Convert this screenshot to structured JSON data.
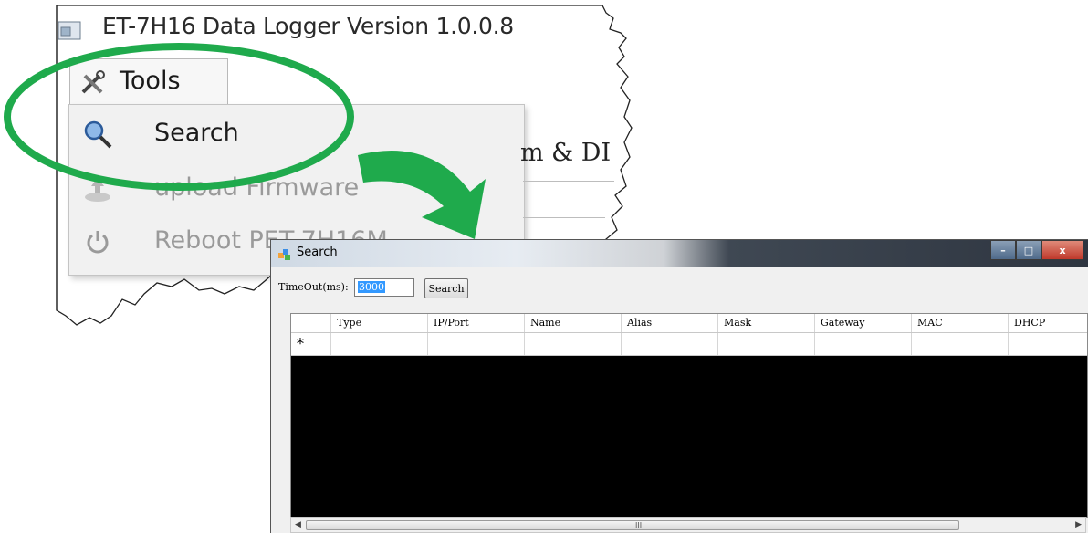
{
  "background_window": {
    "title": "ET-7H16 Data Logger Version 1.0.0.8",
    "tools_tab_label": "Tools",
    "menu_items": [
      {
        "label": "Search",
        "icon": "search-icon",
        "enabled": true
      },
      {
        "label": "upload Firmware",
        "icon": "upload-icon",
        "enabled": false
      },
      {
        "label": "Reboot PET-7H16M",
        "icon": "power-icon",
        "enabled": false
      }
    ],
    "partial_tab_text": "m & DI"
  },
  "annotation": {
    "highlight_color": "#1faa4c",
    "arrow_color": "#1faa4c"
  },
  "search_dialog": {
    "title": "Search",
    "window_buttons": {
      "minimize": "–",
      "maximize": "□",
      "close": "x"
    },
    "timeout_label": "TimeOut(ms):",
    "timeout_value": "3000",
    "search_button": "Search",
    "grid": {
      "columns": [
        "Type",
        "IP/Port",
        "Name",
        "Alias",
        "Mask",
        "Gateway",
        "MAC",
        "DHCP"
      ],
      "new_row_marker": "*"
    },
    "scrollbar_grip": "III"
  }
}
